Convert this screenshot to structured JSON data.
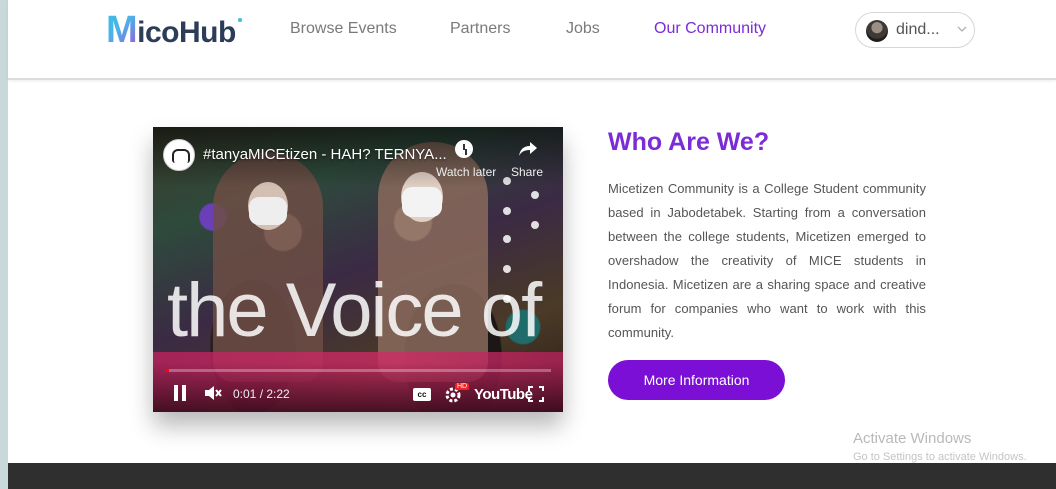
{
  "header": {
    "logo_text": "icoHub",
    "logo_initial": "M",
    "nav": [
      {
        "label": "Browse Events",
        "active": false
      },
      {
        "label": "Partners",
        "active": false
      },
      {
        "label": "Jobs",
        "active": false
      },
      {
        "label": "Our Community",
        "active": true
      }
    ],
    "user": {
      "name": "dind...",
      "avatar_icon": "user-avatar"
    }
  },
  "video": {
    "title": "#tanyaMICEtizen - HAH? TERNYA...",
    "watch_later_label": "Watch later",
    "share_label": "Share",
    "overlay_text": "the Voice of",
    "time": "0:01 / 2:22",
    "progress": 0.01,
    "cc_label": "cc",
    "hd_badge": "HD",
    "youtube_label": "YouTube"
  },
  "about": {
    "heading": "Who Are We?",
    "body": "Micetizen Community is a College Student community based in Jabodetabek. Starting from a conversation between the college students, Micetizen emerged to overshadow the creativity of MICE students in Indonesia. Micetizen are a sharing space and creative forum for companies who want to work with this community.",
    "button_label": "More Information"
  },
  "watermark": {
    "title": "Activate Windows",
    "subtitle": "Go to Settings to activate Windows."
  },
  "colors": {
    "accent": "#7b2cd6",
    "button": "#7b0fd6",
    "footer": "#2f2f2f"
  }
}
